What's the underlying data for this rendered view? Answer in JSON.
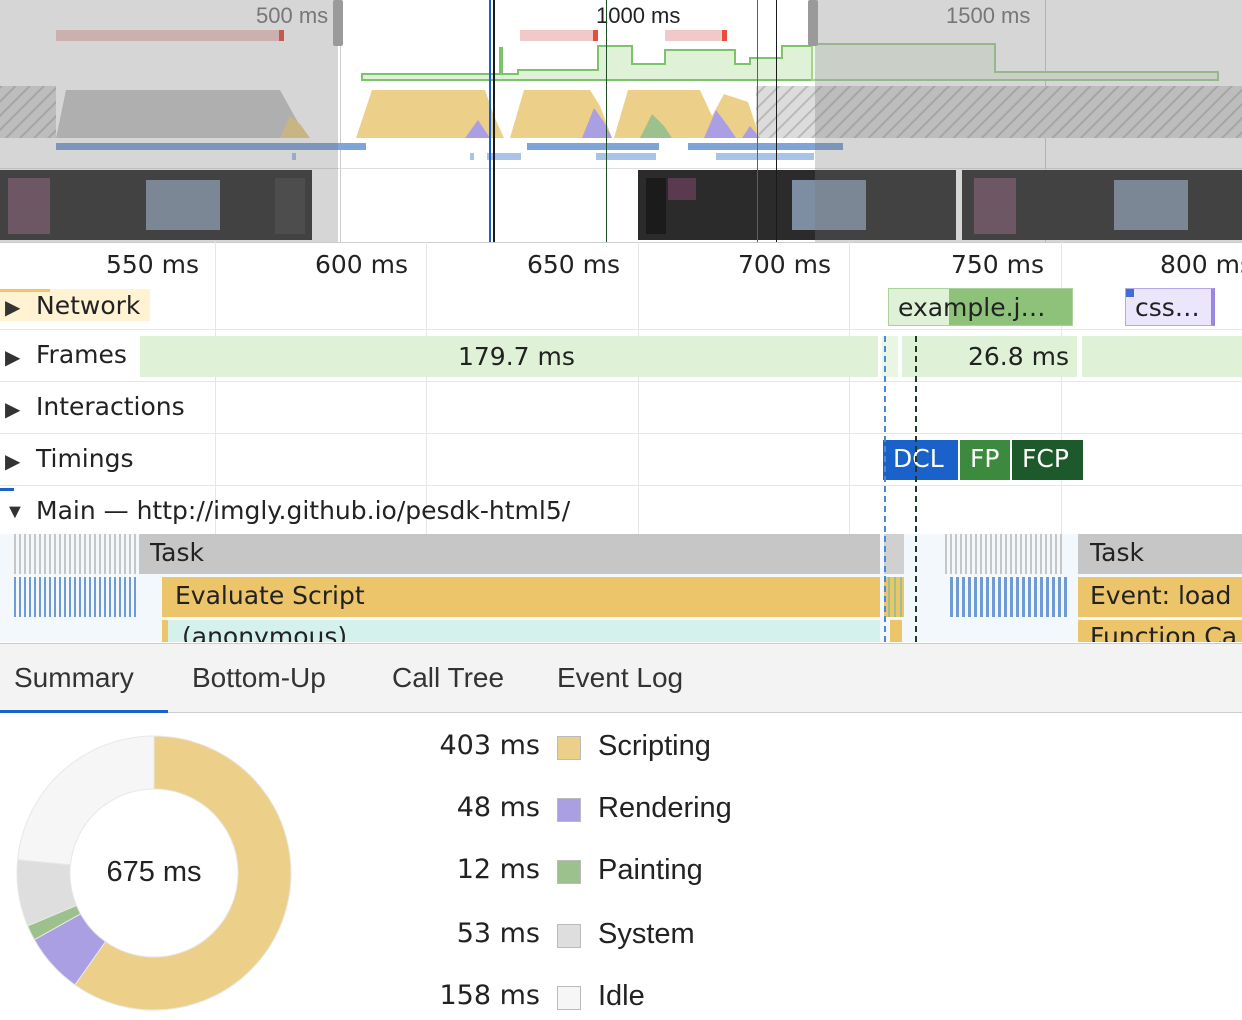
{
  "overview": {
    "time_labels": [
      "500 ms",
      "1000 ms",
      "1500 ms"
    ]
  },
  "ruler": {
    "ticks": [
      "550 ms",
      "600 ms",
      "650 ms",
      "700 ms",
      "750 ms",
      "800 ms"
    ]
  },
  "tracks": {
    "network": {
      "label": "Network",
      "requests": [
        "example.j…",
        "css…"
      ]
    },
    "frames": {
      "label": "Frames",
      "durations": [
        "179.7 ms",
        "26.8 ms"
      ]
    },
    "interactions": {
      "label": "Interactions"
    },
    "timings": {
      "label": "Timings",
      "markers": [
        "DCL",
        "FP",
        "FCP"
      ]
    },
    "main": {
      "label": "Main — http://imgly.github.io/pesdk-html5/",
      "events": [
        "Task",
        "Evaluate Script",
        "(anonymous)",
        "Task",
        "Event: load",
        "Function Ca"
      ]
    }
  },
  "tabs": [
    "Summary",
    "Bottom-Up",
    "Call Tree",
    "Event Log"
  ],
  "summary": {
    "total": "675 ms",
    "items": [
      {
        "value": "403 ms",
        "label": "Scripting",
        "color": "#ecd08a",
        "ms": 403
      },
      {
        "value": "48 ms",
        "label": "Rendering",
        "color": "#ab9fe3",
        "ms": 48
      },
      {
        "value": "12 ms",
        "label": "Painting",
        "color": "#9cc18c",
        "ms": 12
      },
      {
        "value": "53 ms",
        "label": "System",
        "color": "#dedede",
        "ms": 53
      },
      {
        "value": "158 ms",
        "label": "Idle",
        "color": "#f6f6f6",
        "ms": 158
      }
    ]
  }
}
